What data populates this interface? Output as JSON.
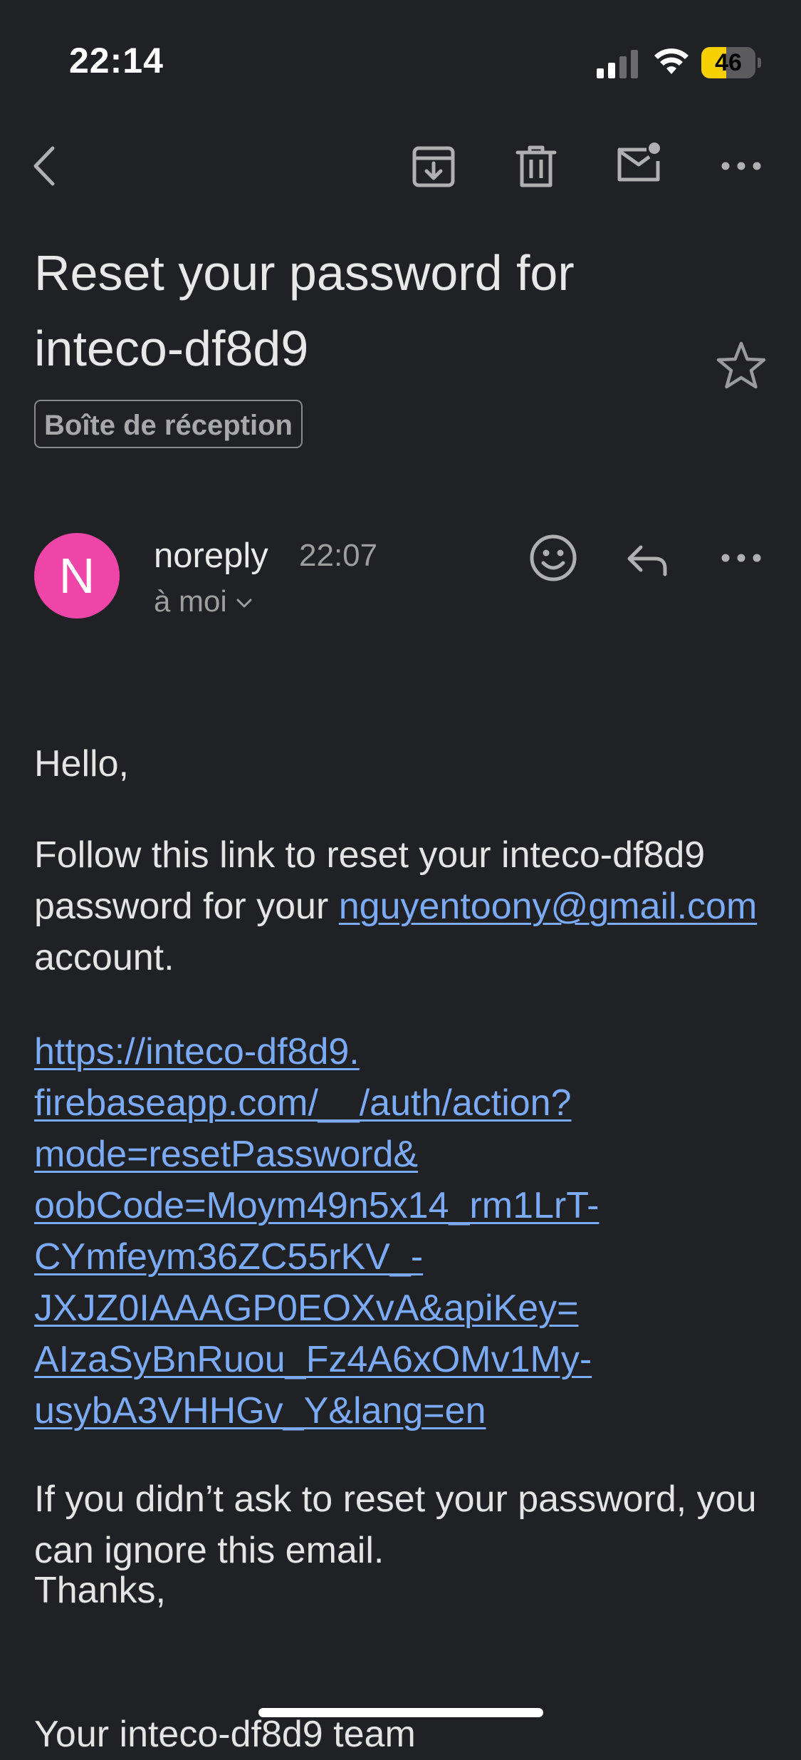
{
  "status_bar": {
    "time": "22:14",
    "battery_level": "46",
    "battery_fraction": 0.46
  },
  "toolbar": {
    "back_icon": "back-chevron-icon",
    "archive_icon": "archive-icon",
    "delete_icon": "trash-icon",
    "unread_icon": "mark-unread-icon",
    "more_icon": "more-horizontal-icon"
  },
  "email": {
    "subject": "Reset your password for inteco-df8d9",
    "label": "Boîte de réception",
    "sender": {
      "initial": "N",
      "name": "noreply",
      "time": "22:07",
      "recipient": "à moi",
      "avatar_color": "#ee46a8"
    },
    "body": {
      "greeting": "Hello,",
      "line1_prefix": "Follow this link to reset your inteco-df8d9 password for your ",
      "email_link": "nguyentoony@gmail.com",
      "line1_suffix": " account.",
      "reset_url": "https://inteco-df8d9.firebaseapp.com/__/auth/action?mode=resetPassword&oobCode=Moym49n5x14_rm1LrT-CYmfeym36ZC55rKV_-JXJZ0IAAAGP0EOXvA&apiKey=AIzaSyBnRuou_Fz4A6xOMv1My-usybA3VHHGv_Y&lang=en",
      "reset_url_lines": [
        "https://inteco-df8d9.",
        "firebaseapp.com/__/auth/action?",
        "mode=resetPassword&",
        "oobCode=Moym49n5x14_rm1LrT-",
        "CYmfeym36ZC55rKV_-",
        "JXJZ0IAAAGP0EOXvA&apiKey=",
        "AIzaSyBnRuou_Fz4A6xOMv1My-",
        "usybA3VHHGv_Y&lang=en"
      ],
      "ignore_text": "If you didn’t ask to reset your password, you can ignore this email.",
      "thanks": "Thanks,",
      "signature": "Your inteco-df8d9 team"
    }
  },
  "colors": {
    "background": "#202124",
    "link": "#7baaf7",
    "battery": "#f7d000"
  }
}
